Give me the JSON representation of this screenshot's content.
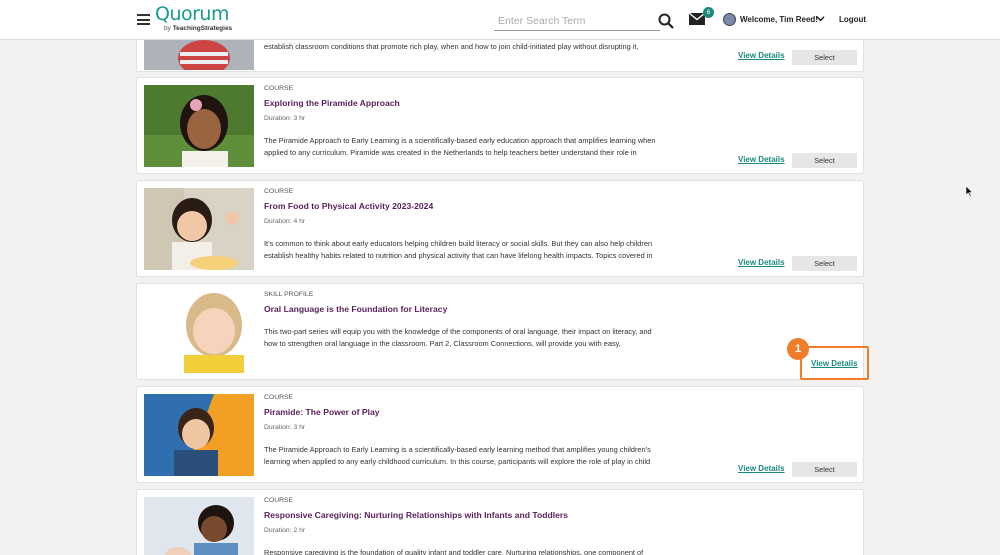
{
  "header": {
    "logo": "Quorum",
    "logo_by": "by",
    "logo_brand": "TeachingStrategies",
    "search_placeholder": "Enter Search Term",
    "mail_count": "6",
    "welcome": "Welcome, Tim Reed!",
    "logout": "Logout"
  },
  "cards": [
    {
      "type": "",
      "title": "",
      "duration": "",
      "desc_line1": "establish classroom conditions that promote rich play, when and how to join child-initiated play without disrupting it,",
      "desc_line2": "",
      "view_details": "View Details",
      "select": "Select"
    },
    {
      "type": "COURSE",
      "title": "Exploring the Piramide Approach",
      "duration": "Duration: 3 hr",
      "desc_line1": "The Piramide Approach to Early Learning is a scientifically-based early education approach that amplifies learning when",
      "desc_line2": "applied to any curriculum. Piramide was created in the Netherlands to help teachers better understand their role in",
      "view_details": "View Details",
      "select": "Select"
    },
    {
      "type": "COURSE",
      "title": "From Food to Physical Activity 2023-2024",
      "duration": "Duration: 4 hr",
      "desc_line1": "It’s common to think about early educators helping children build literacy or social skills. But they can also help children",
      "desc_line2": "establish healthy habits related to nutrition and physical activity that can have lifelong health impacts. Topics covered in",
      "view_details": "View Details",
      "select": "Select"
    },
    {
      "type": "SKILL PROFILE",
      "title": "Oral Language is the Foundation for Literacy",
      "duration": "",
      "desc_line1": "This two-part series will equip you with the knowledge of the components of oral language, their impact on literacy, and",
      "desc_line2": "how to strengthen oral language in the classroom. Part 2, Classroom Connections, will provide you with easy,",
      "view_details": "View Details",
      "select": ""
    },
    {
      "type": "COURSE",
      "title": "Piramide: The Power of Play",
      "duration": "Duration: 3 hr",
      "desc_line1": "The Piramide Approach to Early Learning is a scientifically-based early learning method that amplifies young children’s",
      "desc_line2": "learning when applied to any early childhood curriculum. In this course, participants will explore the role of play in child",
      "view_details": "View Details",
      "select": "Select"
    },
    {
      "type": "COURSE",
      "title": "Responsive Caregiving: Nurturing Relationships with Infants and Toddlers",
      "duration": "Duration: 2 hr",
      "desc_line1": "Responsive caregiving is the foundation of quality infant and toddler care. Nurturing relationships, one component of",
      "desc_line2": "",
      "view_details": "",
      "select": ""
    }
  ],
  "callout": {
    "step": "1"
  },
  "colors": {
    "accent": "#1a8a80",
    "title": "#5a1f5a",
    "highlight": "#ef7d2c"
  }
}
